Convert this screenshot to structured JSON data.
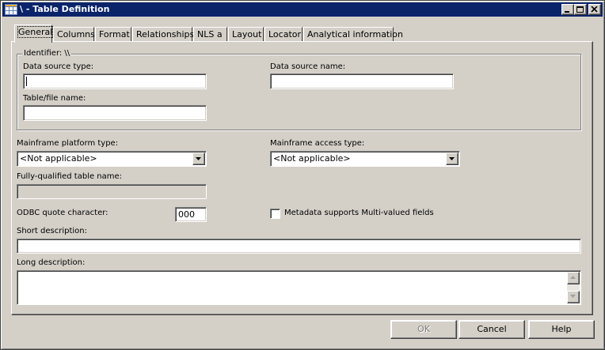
{
  "window": {
    "title": "\\ - Table Definition",
    "controls": {
      "minimize": "minimize",
      "maximize": "maximize",
      "close": "close"
    }
  },
  "tabs": [
    {
      "label": "General",
      "active": true
    },
    {
      "label": "Columns"
    },
    {
      "label": "Format"
    },
    {
      "label": "Relationships"
    },
    {
      "label": "NLS a"
    },
    {
      "label": "Layout"
    },
    {
      "label": "Locator"
    },
    {
      "label": "Analytical information"
    }
  ],
  "identifier": {
    "group_label": "Identifier: \\\\",
    "data_source_type_label": "Data source type:",
    "data_source_type_value": "",
    "data_source_name_label": "Data source name:",
    "data_source_name_value": "",
    "table_file_name_label": "Table/file name:",
    "table_file_name_value": ""
  },
  "mainframe": {
    "platform_type_label": "Mainframe platform type:",
    "platform_type_value": "<Not applicable>",
    "access_type_label": "Mainframe access type:",
    "access_type_value": "<Not applicable>"
  },
  "fully_qualified": {
    "label": "Fully-qualified table name:",
    "value": ""
  },
  "odbc": {
    "label": "ODBC quote character:",
    "value": "000"
  },
  "multivalued": {
    "label": "Metadata supports Multi-valued fields",
    "checked": false
  },
  "short_description": {
    "label": "Short description:",
    "value": ""
  },
  "long_description": {
    "label": "Long description:",
    "value": ""
  },
  "buttons": {
    "ok": "OK",
    "cancel": "Cancel",
    "help": "Help"
  },
  "colors": {
    "titlebar": "#0a246a",
    "face": "#d4d0c8"
  }
}
